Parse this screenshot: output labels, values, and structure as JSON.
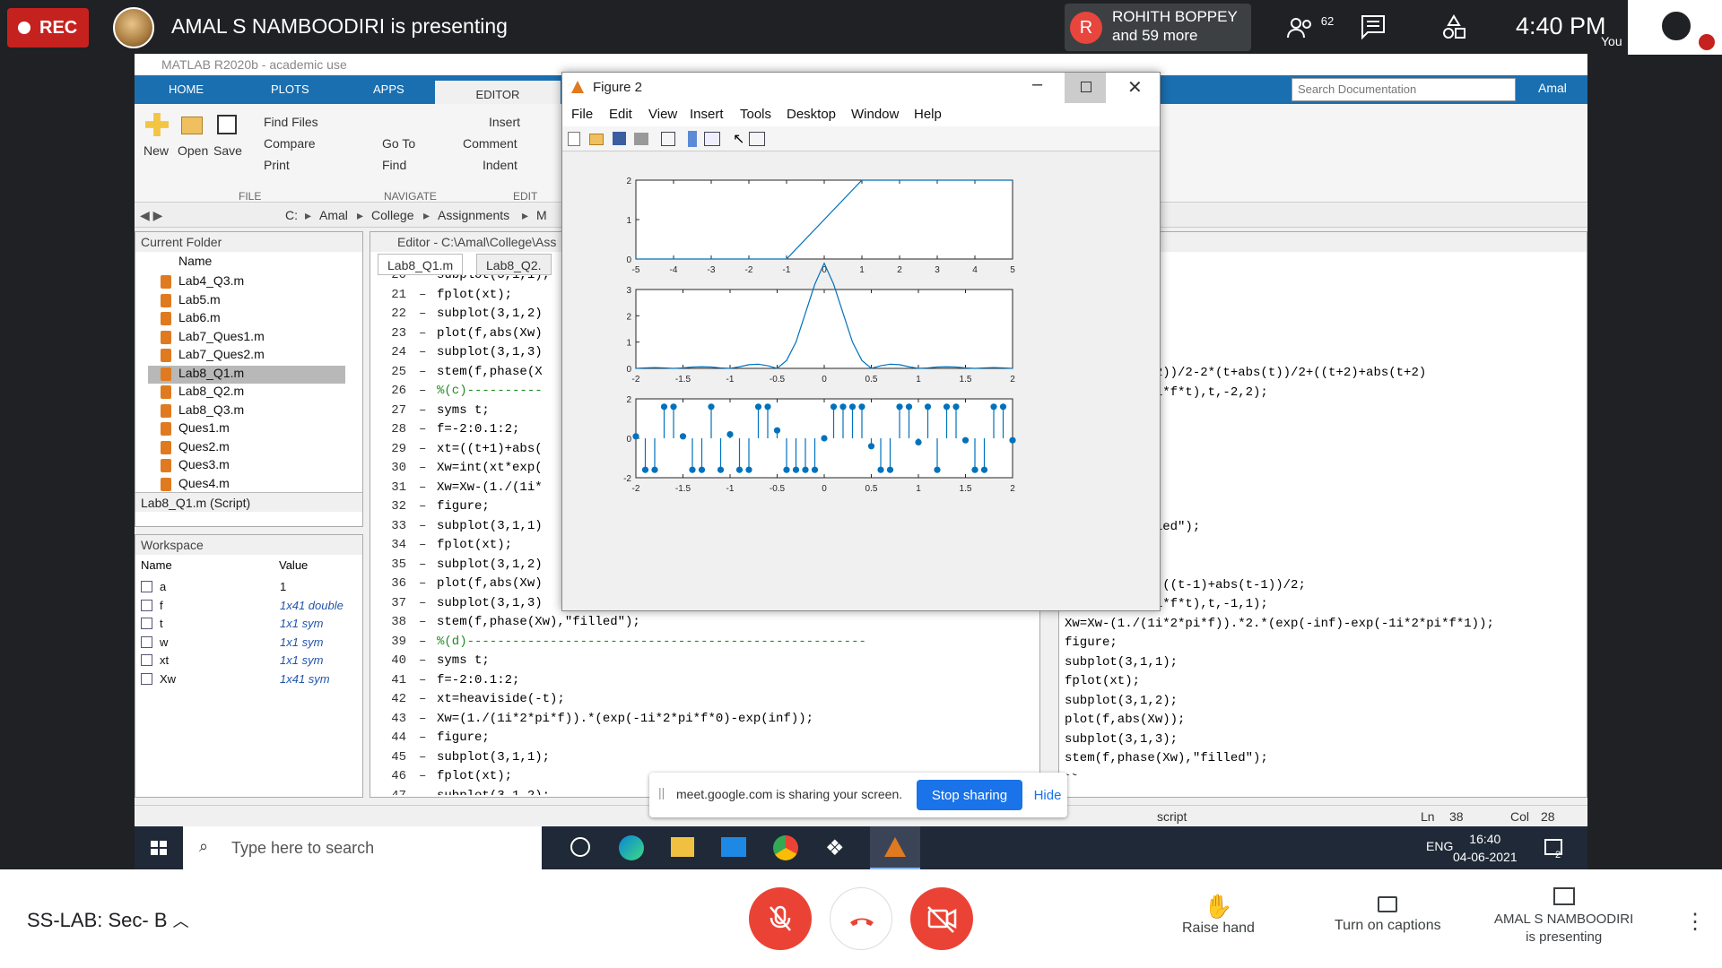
{
  "meet": {
    "rec_label": "REC",
    "presenting_title": "AMAL S NAMBOODIRI is presenting",
    "participant_initial": "R",
    "participant_name": "ROHITH BOPPEY",
    "participant_more": "and 59 more",
    "people_count": "62",
    "clock": "4:40 PM",
    "you_label": "You",
    "meeting_name": "SS-LAB: Sec- B",
    "raise_hand": "Raise hand",
    "captions": "Turn on captions",
    "presenting_line1": "AMAL S NAMBOODIRI",
    "presenting_line2": "is presenting"
  },
  "matlab": {
    "window_title": "MATLAB R2020b - academic use",
    "tabs": [
      "HOME",
      "PLOTS",
      "APPS",
      "EDITOR"
    ],
    "ribbon": {
      "new": "New",
      "open": "Open",
      "save": "Save",
      "find_files": "Find Files",
      "compare": "Compare",
      "print": "Print",
      "go_to": "Go To",
      "find": "Find",
      "insert": "Insert",
      "comment": "Comment",
      "indent": "Indent",
      "sec_file": "FILE",
      "sec_navigate": "NAVIGATE",
      "sec_edit": "EDIT"
    },
    "search_placeholder": "Search Documentation",
    "user": "Amal",
    "path": [
      "C:",
      "Amal",
      "College",
      "Assignments",
      "M"
    ],
    "current_folder": {
      "title": "Current Folder",
      "col": "Name",
      "items": [
        "Lab4_Q3.m",
        "Lab5.m",
        "Lab6.m",
        "Lab7_Ques1.m",
        "Lab7_Ques2.m",
        "Lab8_Q1.m",
        "Lab8_Q2.m",
        "Lab8_Q3.m",
        "Ques1.m",
        "Ques2.m",
        "Ques3.m",
        "Ques4.m"
      ],
      "selected": "Lab8_Q1.m",
      "detail": "Lab8_Q1.m (Script)"
    },
    "workspace": {
      "title": "Workspace",
      "col_name": "Name",
      "col_value": "Value",
      "rows": [
        {
          "name": "a",
          "value": "1"
        },
        {
          "name": "f",
          "value": "1x41 double"
        },
        {
          "name": "t",
          "value": "1x1 sym"
        },
        {
          "name": "w",
          "value": "1x1 sym"
        },
        {
          "name": "xt",
          "value": "1x1 sym"
        },
        {
          "name": "Xw",
          "value": "1x41 sym"
        }
      ]
    },
    "editor": {
      "title": "Editor - C:\\Amal\\College\\Ass",
      "tab1": "Lab8_Q1.m",
      "tab2": "Lab8_Q2.",
      "lines": [
        {
          "n": "20",
          "c": "subplot(3,1,1);"
        },
        {
          "n": "21",
          "c": "fplot(xt);"
        },
        {
          "n": "22",
          "c": "subplot(3,1,2)"
        },
        {
          "n": "23",
          "c": "plot(f,abs(Xw)"
        },
        {
          "n": "24",
          "c": "subplot(3,1,3)"
        },
        {
          "n": "25",
          "c": "stem(f,phase(X"
        },
        {
          "n": "26",
          "c": "%(c)----------"
        },
        {
          "n": "27",
          "c": "syms t;"
        },
        {
          "n": "28",
          "c": "f=-2:0.1:2;"
        },
        {
          "n": "29",
          "c": "xt=((t+1)+abs("
        },
        {
          "n": "30",
          "c": "Xw=int(xt*exp("
        },
        {
          "n": "31",
          "c": "Xw=Xw-(1./(1i*"
        },
        {
          "n": "32",
          "c": "figure;"
        },
        {
          "n": "33",
          "c": "subplot(3,1,1)"
        },
        {
          "n": "34",
          "c": "fplot(xt);"
        },
        {
          "n": "35",
          "c": "subplot(3,1,2)"
        },
        {
          "n": "36",
          "c": "plot(f,abs(Xw)"
        },
        {
          "n": "37",
          "c": "subplot(3,1,3)"
        },
        {
          "n": "38",
          "c": "stem(f,phase(Xw),\"filled\");"
        },
        {
          "n": "39",
          "c": "%(d)-----------------------------------------------------"
        },
        {
          "n": "40",
          "c": "syms t;"
        },
        {
          "n": "41",
          "c": "f=-2:0.1:2;"
        },
        {
          "n": "42",
          "c": "xt=heaviside(-t);"
        },
        {
          "n": "43",
          "c": "Xw=(1./(1i*2*pi*f)).*(exp(-1i*2*pi*f*0)-exp(inf));"
        },
        {
          "n": "44",
          "c": "figure;"
        },
        {
          "n": "45",
          "c": "subplot(3,1,1);"
        },
        {
          "n": "46",
          "c": "fplot(xt);"
        },
        {
          "n": "47",
          "c": "subplot(3,1,2);"
        }
      ]
    },
    "command_window": {
      "title": "ow",
      "lines": [
        ",1,1);",
        ";",
        "xt);",
        "xt);",
        ";",
        "2;",
        "(t-2)+abs(t-2))/2-2*(t+abs(t))/2+((t+2)+abs(t+2)",
        "*exp(-1i*2*pi*f*t),t,-2,2);",
        "",
        ",1,1);",
        ";",
        ",1,2);",
        "s(Xw));",
        ",1,3);",
        "ase(Xw),\"filled\");",
        "",
        "2;",
        "+abs(t+1))/2-((t-1)+abs(t-1))/2;",
        "*exp(-1i*2*pi*f*t),t,-1,1);",
        "Xw=Xw-(1./(1i*2*pi*f)).*2.*(exp(-inf)-exp(-1i*2*pi*f*1));",
        "figure;",
        "subplot(3,1,1);",
        "fplot(xt);",
        "subplot(3,1,2);",
        "plot(f,abs(Xw));",
        "subplot(3,1,3);",
        "stem(f,phase(Xw),\"filled\");"
      ],
      "prompt": ">>"
    },
    "status": {
      "type": "script",
      "ln_label": "Ln",
      "ln": "38",
      "col_label": "Col",
      "col": "28"
    }
  },
  "figure": {
    "title": "Figure 2",
    "menu": [
      "File",
      "Edit",
      "View",
      "Insert",
      "Tools",
      "Desktop",
      "Window",
      "Help"
    ]
  },
  "chart_data": [
    {
      "type": "line",
      "x": [
        -5,
        -1,
        1,
        5
      ],
      "y": [
        0,
        0,
        2,
        2
      ],
      "xlim": [
        -5,
        5
      ],
      "ylim": [
        0,
        2
      ],
      "xticks": [
        "-5",
        "-4",
        "-3",
        "-2",
        "-1",
        "0",
        "1",
        "2",
        "3",
        "4",
        "5"
      ],
      "yticks": [
        "0",
        "1",
        "2"
      ],
      "color": "#0072BD"
    },
    {
      "type": "line",
      "x": [
        -2,
        -1.9,
        -1.8,
        -1.7,
        -1.6,
        -1.5,
        -1.4,
        -1.3,
        -1.2,
        -1.1,
        -1,
        -0.9,
        -0.8,
        -0.7,
        -0.6,
        -0.5,
        -0.4,
        -0.3,
        -0.2,
        -0.1,
        0,
        0.1,
        0.2,
        0.3,
        0.4,
        0.5,
        0.6,
        0.7,
        0.8,
        0.9,
        1,
        1.1,
        1.2,
        1.3,
        1.4,
        1.5,
        1.6,
        1.7,
        1.8,
        1.9,
        2
      ],
      "y": [
        0,
        0.02,
        0.03,
        0.02,
        0,
        0.02,
        0.05,
        0.06,
        0.05,
        0.02,
        0,
        0.06,
        0.14,
        0.16,
        0.1,
        0,
        0.3,
        1.0,
        2.1,
        3.2,
        4.0,
        3.2,
        2.1,
        1.0,
        0.3,
        0,
        0.1,
        0.16,
        0.14,
        0.06,
        0,
        0.02,
        0.05,
        0.06,
        0.05,
        0.02,
        0,
        0.02,
        0.03,
        0.02,
        0
      ],
      "xlim": [
        -2,
        2
      ],
      "ylim": [
        0,
        3
      ],
      "xticks": [
        "-2",
        "-1.5",
        "-1",
        "-0.5",
        "0",
        "0.5",
        "1",
        "1.5",
        "2"
      ],
      "yticks": [
        "0",
        "1",
        "2",
        "3"
      ],
      "color": "#0072BD"
    },
    {
      "type": "stem",
      "x": [
        -2,
        -1.9,
        -1.8,
        -1.7,
        -1.6,
        -1.5,
        -1.4,
        -1.3,
        -1.2,
        -1.1,
        -1,
        -0.9,
        -0.8,
        -0.7,
        -0.6,
        -0.5,
        -0.4,
        -0.3,
        -0.2,
        -0.1,
        0,
        0.1,
        0.2,
        0.3,
        0.4,
        0.5,
        0.6,
        0.7,
        0.8,
        0.9,
        1,
        1.1,
        1.2,
        1.3,
        1.4,
        1.5,
        1.6,
        1.7,
        1.8,
        1.9,
        2
      ],
      "y": [
        0.1,
        -1.6,
        -1.6,
        1.6,
        1.6,
        0.1,
        -1.6,
        -1.6,
        1.6,
        -1.6,
        0.2,
        -1.6,
        -1.6,
        1.6,
        1.6,
        0.4,
        -1.6,
        -1.6,
        -1.6,
        -1.6,
        0,
        1.6,
        1.6,
        1.6,
        1.6,
        -0.4,
        -1.6,
        -1.6,
        1.6,
        1.6,
        -0.2,
        1.6,
        -1.6,
        1.6,
        1.6,
        -0.1,
        -1.6,
        -1.6,
        1.6,
        1.6,
        -0.1
      ],
      "xlim": [
        -2,
        2
      ],
      "ylim": [
        -2,
        2
      ],
      "xticks": [
        "-2",
        "-1.5",
        "-1",
        "-0.5",
        "0",
        "0.5",
        "1",
        "1.5",
        "2"
      ],
      "yticks": [
        "-2",
        "0",
        "2"
      ],
      "color": "#0072BD"
    }
  ],
  "share_banner": {
    "text": "meet.google.com is sharing your screen.",
    "stop": "Stop sharing",
    "hide": "Hide"
  },
  "taskbar": {
    "search": "Type here to search",
    "lang": "ENG",
    "time": "16:40",
    "date": "04-06-2021",
    "notif_count": "2"
  }
}
